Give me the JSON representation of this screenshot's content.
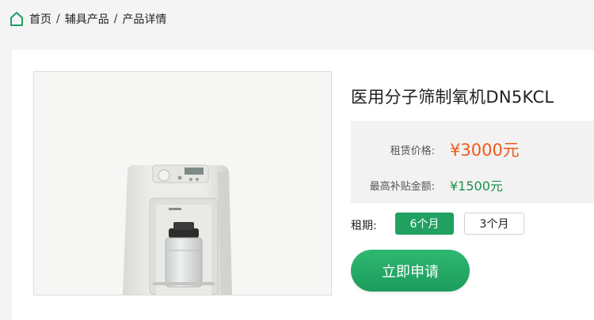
{
  "breadcrumb": {
    "items": [
      "首页",
      "辅具产品",
      "产品详情"
    ],
    "separator": "/",
    "icon": "home-icon"
  },
  "product": {
    "title": "医用分子筛制氧机DN5KCL",
    "image": "oxygen-concentrator-photo",
    "price_label": "租赁价格:",
    "price_value": "¥3000元",
    "subsidy_label": "最高补贴金额:",
    "subsidy_value": "¥1500元"
  },
  "rental": {
    "label": "租期:",
    "options": [
      "6个月",
      "3个月"
    ],
    "selected": "6个月"
  },
  "apply_label": "立即申请",
  "colors": {
    "accent": "#21a062",
    "price": "#f05a1a",
    "subsidy": "#1f8f4e",
    "background": "#f4f4f4"
  }
}
